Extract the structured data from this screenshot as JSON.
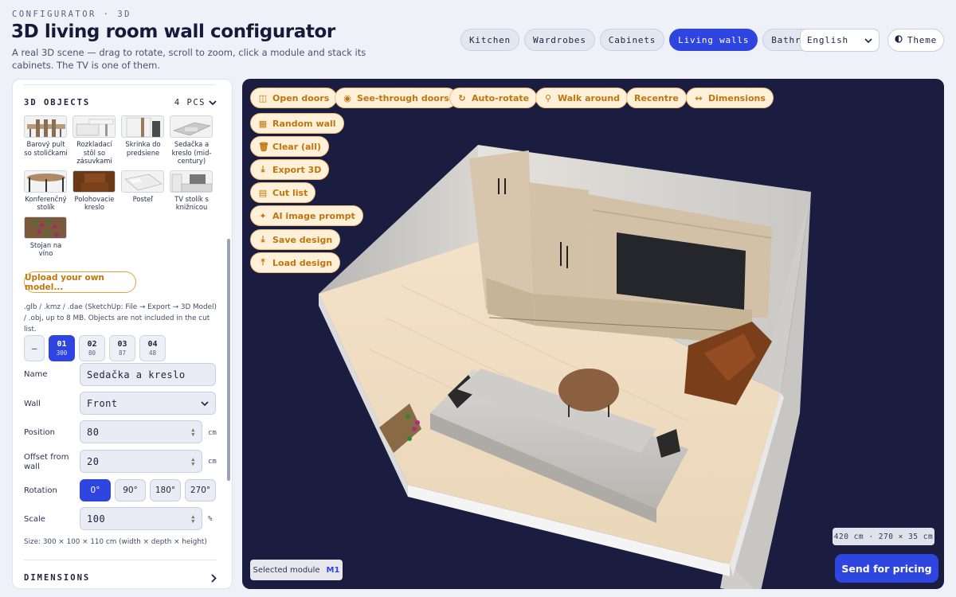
{
  "header": {
    "eyebrow": "CONFIGURATOR · 3D",
    "title": "3D living room wall configurator",
    "subtitle": "A real 3D scene — drag to rotate, scroll to zoom, click a module and stack its cabinets. The TV is one of them."
  },
  "categories": [
    {
      "label": "Kitchen",
      "active": false
    },
    {
      "label": "Wardrobes",
      "active": false
    },
    {
      "label": "Cabinets",
      "active": false
    },
    {
      "label": "Living walls",
      "active": true
    },
    {
      "label": "Bathroom",
      "active": false
    }
  ],
  "language": {
    "value": "English"
  },
  "theme": {
    "label": "Theme",
    "icon": "half-circle-icon"
  },
  "objects_section": {
    "title": "3D OBJECTS",
    "count": "4 PCS",
    "items": [
      {
        "label": "Barový pult so stoličkami",
        "icon": "bar-counter-thumbnail"
      },
      {
        "label": "Rozkladací stôl so zásuvkami",
        "icon": "extending-table-thumbnail"
      },
      {
        "label": "Skrinka do predsiene",
        "icon": "hallway-cabinet-thumbnail"
      },
      {
        "label": "Sedačka a kreslo (mid-century)",
        "icon": "sofa-armchair-thumbnail"
      },
      {
        "label": "Konferenčný stolík",
        "icon": "coffee-table-thumbnail"
      },
      {
        "label": "Polohovacie kreslo",
        "icon": "recliner-thumbnail"
      },
      {
        "label": "Posteľ",
        "icon": "bed-thumbnail"
      },
      {
        "label": "TV stolík s knižnicou",
        "icon": "tv-stand-thumbnail"
      },
      {
        "label": "Stojan na víno",
        "icon": "wine-rack-thumbnail"
      }
    ],
    "upload_label": "Upload your own model...",
    "upload_note": ".glb / .kmz / .dae (SketchUp: File → Export → 3D Model) / .obj, up to 8 MB. Objects are not included in the cut list."
  },
  "modules": [
    {
      "num": "—",
      "width": "",
      "dash": true
    },
    {
      "num": "01",
      "width": "300",
      "active": true
    },
    {
      "num": "02",
      "width": "80"
    },
    {
      "num": "03",
      "width": "87"
    },
    {
      "num": "04",
      "width": "48"
    }
  ],
  "form": {
    "name_label": "Name",
    "name_value": "Sedačka a kreslo",
    "wall_label": "Wall",
    "wall_value": "Front",
    "position_label": "Position",
    "position_value": "80",
    "position_unit": "cm",
    "offset_label": "Offset from wall",
    "offset_value": "20",
    "offset_unit": "cm",
    "rotation_label": "Rotation",
    "rotations": [
      {
        "label": "0°",
        "active": true
      },
      {
        "label": "90°"
      },
      {
        "label": "180°"
      },
      {
        "label": "270°"
      }
    ],
    "scale_label": "Scale",
    "scale_value": "100",
    "scale_unit": "%",
    "size_note": "Size: 300 × 100 × 110 cm (width × depth × height)"
  },
  "dimensions_section": {
    "title": "DIMENSIONS"
  },
  "toolbar": {
    "open_doors": "Open doors",
    "see_through": "See-through doors",
    "auto_rotate": "Auto-rotate",
    "walk_around": "Walk around",
    "recentre": "Recentre",
    "dimensions": "Dimensions",
    "random_wall": "Random wall",
    "clear_all": "Clear (all)",
    "export_3d": "Export 3D",
    "cut_list": "Cut list",
    "ai_prompt": "AI image prompt",
    "save_design": "Save design",
    "load_design": "Load design"
  },
  "viewport": {
    "dims_readout": "420 cm · 270 × 35 cm",
    "selected_label": "Selected module",
    "selected_value": "M1",
    "pricing_label": "Send for pricing"
  },
  "colors": {
    "accent": "#2f45e0",
    "tool_bg": "#fff0d9",
    "tool_text": "#c0760c",
    "viewport_bg": "#1a1d40"
  }
}
